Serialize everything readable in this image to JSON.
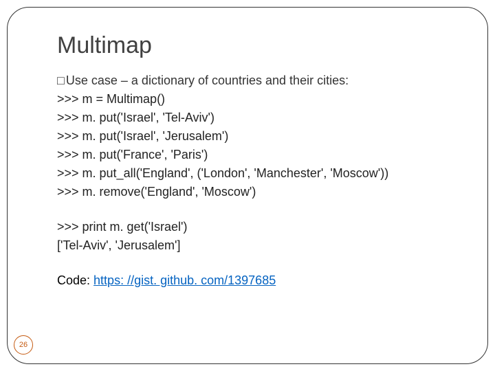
{
  "title": "Multimap",
  "bullet": {
    "marker": "□",
    "text": "Use case – a dictionary of countries and their cities:"
  },
  "code_lines": [
    ">>> m = Multimap()",
    ">>> m. put('Israel', 'Tel-Aviv')",
    ">>> m. put('Israel', 'Jerusalem')",
    ">>> m. put('France', 'Paris')",
    ">>> m. put_all('England', ('London', 'Manchester', 'Moscow'))",
    ">>> m. remove('England', 'Moscow')"
  ],
  "output_lines": [
    ">>> print m. get('Israel')",
    "['Tel-Aviv', 'Jerusalem']"
  ],
  "code_label": "Code: ",
  "code_url": "https: //gist. github. com/1397685",
  "page_number": "26"
}
